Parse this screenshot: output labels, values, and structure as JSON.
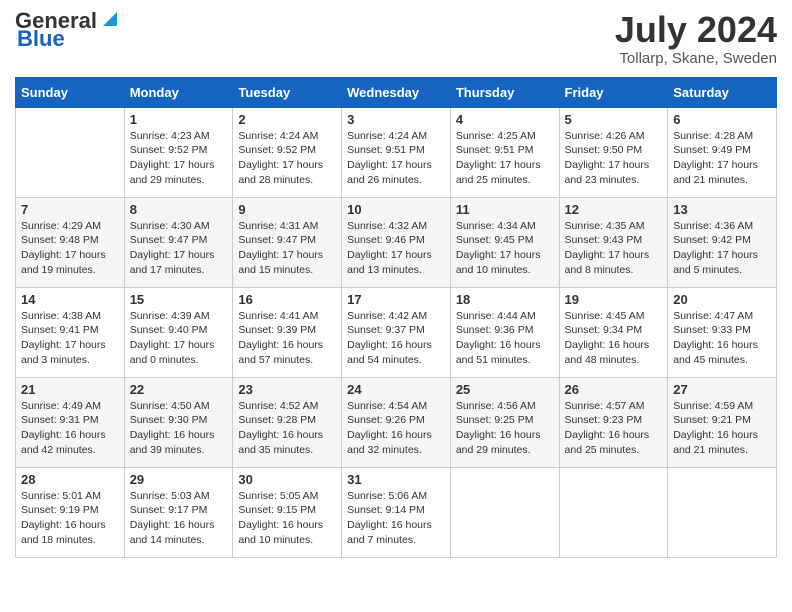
{
  "header": {
    "logo_line1": "General",
    "logo_line2": "Blue",
    "month": "July 2024",
    "location": "Tollarp, Skane, Sweden"
  },
  "days_of_week": [
    "Sunday",
    "Monday",
    "Tuesday",
    "Wednesday",
    "Thursday",
    "Friday",
    "Saturday"
  ],
  "weeks": [
    [
      {
        "day": "",
        "sunrise": "",
        "sunset": "",
        "daylight": ""
      },
      {
        "day": "1",
        "sunrise": "Sunrise: 4:23 AM",
        "sunset": "Sunset: 9:52 PM",
        "daylight": "Daylight: 17 hours and 29 minutes."
      },
      {
        "day": "2",
        "sunrise": "Sunrise: 4:24 AM",
        "sunset": "Sunset: 9:52 PM",
        "daylight": "Daylight: 17 hours and 28 minutes."
      },
      {
        "day": "3",
        "sunrise": "Sunrise: 4:24 AM",
        "sunset": "Sunset: 9:51 PM",
        "daylight": "Daylight: 17 hours and 26 minutes."
      },
      {
        "day": "4",
        "sunrise": "Sunrise: 4:25 AM",
        "sunset": "Sunset: 9:51 PM",
        "daylight": "Daylight: 17 hours and 25 minutes."
      },
      {
        "day": "5",
        "sunrise": "Sunrise: 4:26 AM",
        "sunset": "Sunset: 9:50 PM",
        "daylight": "Daylight: 17 hours and 23 minutes."
      },
      {
        "day": "6",
        "sunrise": "Sunrise: 4:28 AM",
        "sunset": "Sunset: 9:49 PM",
        "daylight": "Daylight: 17 hours and 21 minutes."
      }
    ],
    [
      {
        "day": "7",
        "sunrise": "Sunrise: 4:29 AM",
        "sunset": "Sunset: 9:48 PM",
        "daylight": "Daylight: 17 hours and 19 minutes."
      },
      {
        "day": "8",
        "sunrise": "Sunrise: 4:30 AM",
        "sunset": "Sunset: 9:47 PM",
        "daylight": "Daylight: 17 hours and 17 minutes."
      },
      {
        "day": "9",
        "sunrise": "Sunrise: 4:31 AM",
        "sunset": "Sunset: 9:47 PM",
        "daylight": "Daylight: 17 hours and 15 minutes."
      },
      {
        "day": "10",
        "sunrise": "Sunrise: 4:32 AM",
        "sunset": "Sunset: 9:46 PM",
        "daylight": "Daylight: 17 hours and 13 minutes."
      },
      {
        "day": "11",
        "sunrise": "Sunrise: 4:34 AM",
        "sunset": "Sunset: 9:45 PM",
        "daylight": "Daylight: 17 hours and 10 minutes."
      },
      {
        "day": "12",
        "sunrise": "Sunrise: 4:35 AM",
        "sunset": "Sunset: 9:43 PM",
        "daylight": "Daylight: 17 hours and 8 minutes."
      },
      {
        "day": "13",
        "sunrise": "Sunrise: 4:36 AM",
        "sunset": "Sunset: 9:42 PM",
        "daylight": "Daylight: 17 hours and 5 minutes."
      }
    ],
    [
      {
        "day": "14",
        "sunrise": "Sunrise: 4:38 AM",
        "sunset": "Sunset: 9:41 PM",
        "daylight": "Daylight: 17 hours and 3 minutes."
      },
      {
        "day": "15",
        "sunrise": "Sunrise: 4:39 AM",
        "sunset": "Sunset: 9:40 PM",
        "daylight": "Daylight: 17 hours and 0 minutes."
      },
      {
        "day": "16",
        "sunrise": "Sunrise: 4:41 AM",
        "sunset": "Sunset: 9:39 PM",
        "daylight": "Daylight: 16 hours and 57 minutes."
      },
      {
        "day": "17",
        "sunrise": "Sunrise: 4:42 AM",
        "sunset": "Sunset: 9:37 PM",
        "daylight": "Daylight: 16 hours and 54 minutes."
      },
      {
        "day": "18",
        "sunrise": "Sunrise: 4:44 AM",
        "sunset": "Sunset: 9:36 PM",
        "daylight": "Daylight: 16 hours and 51 minutes."
      },
      {
        "day": "19",
        "sunrise": "Sunrise: 4:45 AM",
        "sunset": "Sunset: 9:34 PM",
        "daylight": "Daylight: 16 hours and 48 minutes."
      },
      {
        "day": "20",
        "sunrise": "Sunrise: 4:47 AM",
        "sunset": "Sunset: 9:33 PM",
        "daylight": "Daylight: 16 hours and 45 minutes."
      }
    ],
    [
      {
        "day": "21",
        "sunrise": "Sunrise: 4:49 AM",
        "sunset": "Sunset: 9:31 PM",
        "daylight": "Daylight: 16 hours and 42 minutes."
      },
      {
        "day": "22",
        "sunrise": "Sunrise: 4:50 AM",
        "sunset": "Sunset: 9:30 PM",
        "daylight": "Daylight: 16 hours and 39 minutes."
      },
      {
        "day": "23",
        "sunrise": "Sunrise: 4:52 AM",
        "sunset": "Sunset: 9:28 PM",
        "daylight": "Daylight: 16 hours and 35 minutes."
      },
      {
        "day": "24",
        "sunrise": "Sunrise: 4:54 AM",
        "sunset": "Sunset: 9:26 PM",
        "daylight": "Daylight: 16 hours and 32 minutes."
      },
      {
        "day": "25",
        "sunrise": "Sunrise: 4:56 AM",
        "sunset": "Sunset: 9:25 PM",
        "daylight": "Daylight: 16 hours and 29 minutes."
      },
      {
        "day": "26",
        "sunrise": "Sunrise: 4:57 AM",
        "sunset": "Sunset: 9:23 PM",
        "daylight": "Daylight: 16 hours and 25 minutes."
      },
      {
        "day": "27",
        "sunrise": "Sunrise: 4:59 AM",
        "sunset": "Sunset: 9:21 PM",
        "daylight": "Daylight: 16 hours and 21 minutes."
      }
    ],
    [
      {
        "day": "28",
        "sunrise": "Sunrise: 5:01 AM",
        "sunset": "Sunset: 9:19 PM",
        "daylight": "Daylight: 16 hours and 18 minutes."
      },
      {
        "day": "29",
        "sunrise": "Sunrise: 5:03 AM",
        "sunset": "Sunset: 9:17 PM",
        "daylight": "Daylight: 16 hours and 14 minutes."
      },
      {
        "day": "30",
        "sunrise": "Sunrise: 5:05 AM",
        "sunset": "Sunset: 9:15 PM",
        "daylight": "Daylight: 16 hours and 10 minutes."
      },
      {
        "day": "31",
        "sunrise": "Sunrise: 5:06 AM",
        "sunset": "Sunset: 9:14 PM",
        "daylight": "Daylight: 16 hours and 7 minutes."
      },
      {
        "day": "",
        "sunrise": "",
        "sunset": "",
        "daylight": ""
      },
      {
        "day": "",
        "sunrise": "",
        "sunset": "",
        "daylight": ""
      },
      {
        "day": "",
        "sunrise": "",
        "sunset": "",
        "daylight": ""
      }
    ]
  ]
}
